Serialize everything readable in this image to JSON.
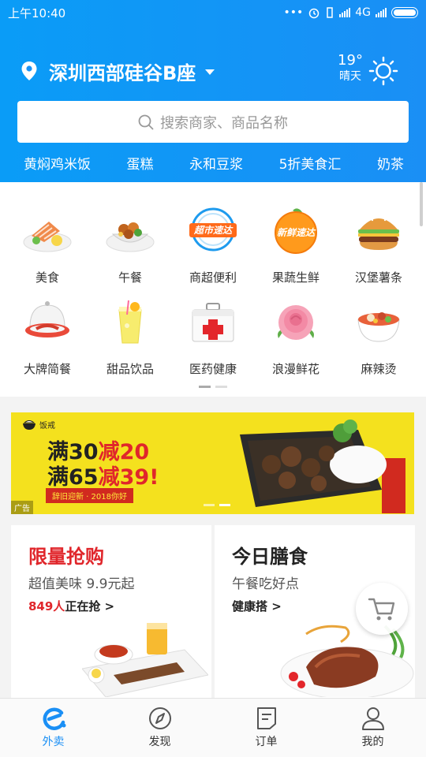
{
  "status_bar": {
    "time": "上午10:40",
    "network": "4G"
  },
  "header": {
    "location": "深圳西部硅谷B座",
    "weather_temp": "19°",
    "weather_text": "晴天",
    "search_placeholder": "搜索商家、商品名称",
    "hot_words": [
      "黄焖鸡米饭",
      "蛋糕",
      "永和豆浆",
      "5折美食汇",
      "奶茶"
    ]
  },
  "categories": [
    {
      "label": "美食",
      "icon": "salmon-plate-icon"
    },
    {
      "label": "午餐",
      "icon": "lunch-bowl-icon"
    },
    {
      "label": "商超便利",
      "icon": "supermarket-express-icon",
      "badge": "超市速达"
    },
    {
      "label": "果蔬生鲜",
      "icon": "fresh-orange-icon",
      "badge": "新鲜速达"
    },
    {
      "label": "汉堡薯条",
      "icon": "burger-icon"
    },
    {
      "label": "大牌简餐",
      "icon": "cloche-dish-icon"
    },
    {
      "label": "甜品饮品",
      "icon": "drink-cup-icon"
    },
    {
      "label": "医药健康",
      "icon": "first-aid-kit-icon"
    },
    {
      "label": "浪漫鲜花",
      "icon": "rose-icon"
    },
    {
      "label": "麻辣烫",
      "icon": "spicy-hotpot-icon"
    }
  ],
  "banner": {
    "brand": "饭戒",
    "line1": "满30减20",
    "line2": "满65减39!",
    "subline": "辞旧迎新 · 2018你好",
    "ad_tag": "广告"
  },
  "promo_cards": [
    {
      "title": "限量抢购",
      "subtitle": "超值美味 9.9元起",
      "count": "849人",
      "action": "正在抢 >",
      "title_color": "#e0262b"
    },
    {
      "title": "今日膳食",
      "subtitle": "午餐吃好点",
      "action": "健康搭 >",
      "title_color": "#222222"
    }
  ],
  "tabs": [
    {
      "label": "外卖",
      "icon": "eleme-logo-icon",
      "active": true
    },
    {
      "label": "发现",
      "icon": "compass-icon",
      "active": false
    },
    {
      "label": "订单",
      "icon": "order-list-icon",
      "active": false
    },
    {
      "label": "我的",
      "icon": "user-icon",
      "active": false
    }
  ],
  "colors": {
    "brand_blue": "#0a9cf7",
    "promo_red": "#e0262b",
    "banner_yellow": "#f4e11e"
  }
}
